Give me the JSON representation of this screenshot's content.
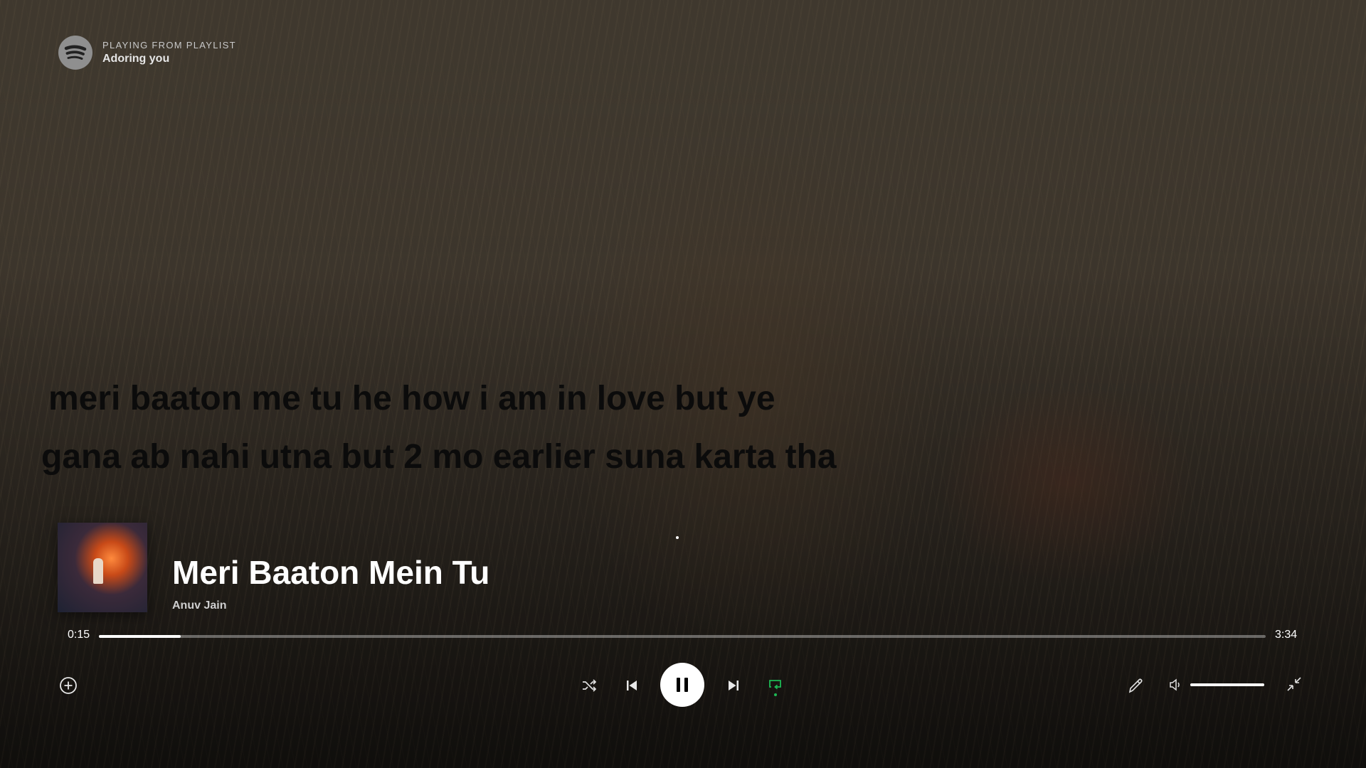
{
  "header": {
    "context_label": "PLAYING FROM PLAYLIST",
    "playlist_name": "Adoring you"
  },
  "lyrics": {
    "lines": [
      "meri baaton me tu he how i am in love but ye",
      "gana ab nahi utna but 2 mo earlier suna karta tha"
    ]
  },
  "track": {
    "title": "Meri Baaton Mein Tu",
    "artist": "Anuv Jain"
  },
  "playback": {
    "current_time": "0:15",
    "duration": "3:34",
    "progress_fraction": 0.07,
    "volume_fraction": 1.0,
    "shuffle": false,
    "repeat": true,
    "state": "playing"
  },
  "icons": {
    "logo": "spotify-icon",
    "add": "plus-circle-icon",
    "shuffle": "shuffle-icon",
    "previous": "skip-previous-icon",
    "pause": "pause-icon",
    "next": "skip-next-icon",
    "repeat": "repeat-icon",
    "connect": "link-icon",
    "volume": "volume-icon",
    "minimize": "collapse-icon"
  },
  "colors": {
    "accent": "#1db954",
    "text_primary": "#ffffff",
    "lyrics_text": "#0b0b0b"
  }
}
